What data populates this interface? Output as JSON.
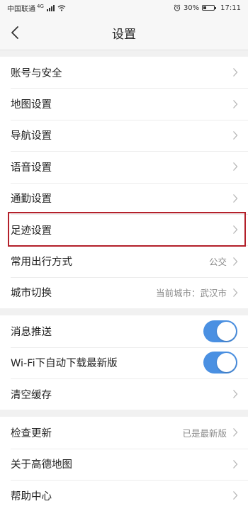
{
  "status_bar": {
    "carrier": "中国联通",
    "network": "4G",
    "battery": "30%",
    "battery_level": 0.3,
    "time": "17:11",
    "icons": [
      "signal-icon",
      "wifi-icon",
      "alarm-icon",
      "battery-icon"
    ]
  },
  "header": {
    "title": "设置",
    "back_icon": "chevron-left-icon"
  },
  "groups": [
    {
      "items": [
        {
          "label": "账号与安全",
          "value": ""
        },
        {
          "label": "地图设置",
          "value": ""
        },
        {
          "label": "导航设置",
          "value": ""
        },
        {
          "label": "语音设置",
          "value": ""
        },
        {
          "label": "通勤设置",
          "value": ""
        },
        {
          "label": "足迹设置",
          "value": ""
        },
        {
          "label": "常用出行方式",
          "value": "公交"
        },
        {
          "label": "城市切换",
          "value": "当前城市：武汉市"
        }
      ]
    },
    {
      "items": [
        {
          "label": "消息推送",
          "toggle": true
        },
        {
          "label": "Wi-Fi下自动下载最新版",
          "toggle": true
        },
        {
          "label": "清空缓存",
          "value": ""
        }
      ]
    },
    {
      "items": [
        {
          "label": "检查更新",
          "value": "已是最新版"
        },
        {
          "label": "关于高德地图",
          "value": ""
        },
        {
          "label": "帮助中心",
          "value": ""
        }
      ]
    }
  ],
  "colors": {
    "toggle_on": "#4a90e2",
    "highlight_border": "#b3202a",
    "background": "#f1f1f1"
  }
}
